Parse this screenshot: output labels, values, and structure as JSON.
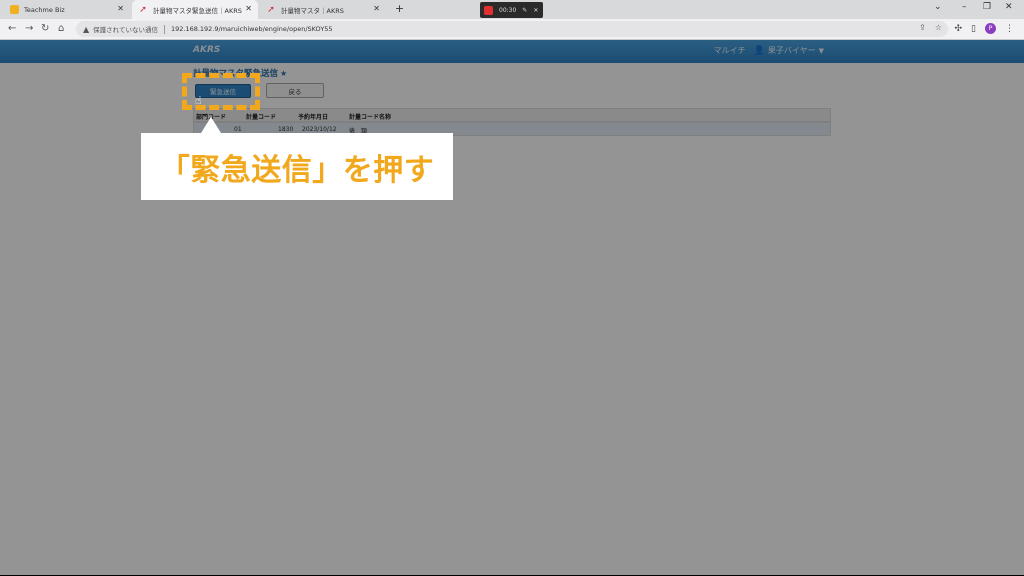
{
  "browser": {
    "tabs": [
      {
        "label": "Teachme Biz",
        "icon": "teachme-icon"
      },
      {
        "label": "計量物マスタ緊急送信｜AKRS",
        "icon": "akrs-icon"
      },
      {
        "label": "計量物マスタ｜AKRS",
        "icon": "akrs-icon"
      }
    ],
    "recorder": {
      "time": "00:30"
    },
    "address": {
      "insecure_label": "保護されていない通信",
      "url": "192.168.192.9/maruichiweb/engine/open/SKOY55"
    }
  },
  "app": {
    "logo": "AKRS",
    "company": "マルイチ",
    "user": "果子バイヤー",
    "page_title": "計量物マスタ緊急送信",
    "buttons": {
      "emergency_send": "緊急送信",
      "back": "戻る"
    },
    "table": {
      "headers": [
        "部門コード",
        "計量コード",
        "予約年月日",
        "計量コード名称"
      ],
      "rows": [
        [
          "01",
          "1830",
          "2023/10/12",
          "俵　類"
        ]
      ]
    }
  },
  "callout": {
    "text": "「緊急送信」を押す"
  },
  "colors": {
    "accent": "#f2a81d",
    "header_blue": "#2f83c6",
    "button_blue": "#2f86c9"
  }
}
